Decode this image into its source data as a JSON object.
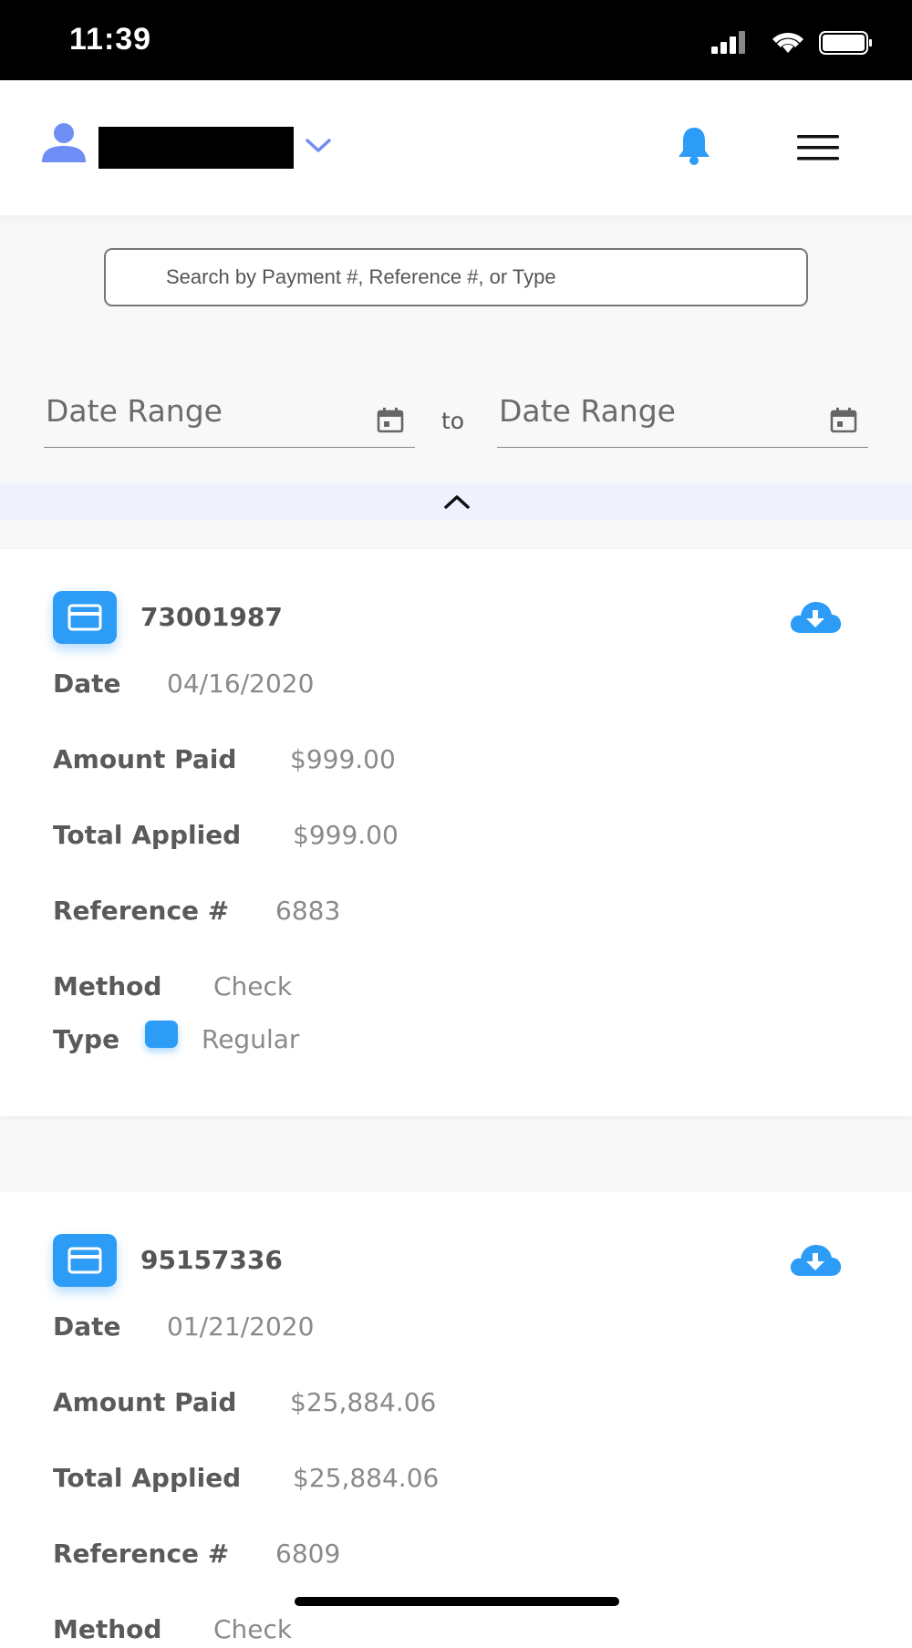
{
  "status_bar": {
    "time": "11:39"
  },
  "header": {
    "user_icon": "user-icon",
    "bell_icon": "bell-icon",
    "menu_icon": "hamburger-menu-icon"
  },
  "search": {
    "placeholder": "Search by Payment #, Reference #, or Type"
  },
  "date_range": {
    "from_label": "Date Range",
    "separator": "to",
    "to_label": "Date Range"
  },
  "colors": {
    "accent": "#2d9cf6",
    "collapse_bar": "#eff2fc"
  },
  "payments": [
    {
      "number": "73001987",
      "date_label": "Date",
      "date": "04/16/2020",
      "amount_paid_label": "Amount Paid",
      "amount_paid": "$999.00",
      "total_applied_label": "Total Applied",
      "total_applied": "$999.00",
      "reference_label": "Reference #",
      "reference": "6883",
      "method_label": "Method",
      "method": "Check",
      "type_label": "Type",
      "type": "Regular"
    },
    {
      "number": "95157336",
      "date_label": "Date",
      "date": "01/21/2020",
      "amount_paid_label": "Amount Paid",
      "amount_paid": "$25,884.06",
      "total_applied_label": "Total Applied",
      "total_applied": "$25,884.06",
      "reference_label": "Reference #",
      "reference": "6809",
      "method_label": "Method",
      "method": "Check"
    }
  ]
}
